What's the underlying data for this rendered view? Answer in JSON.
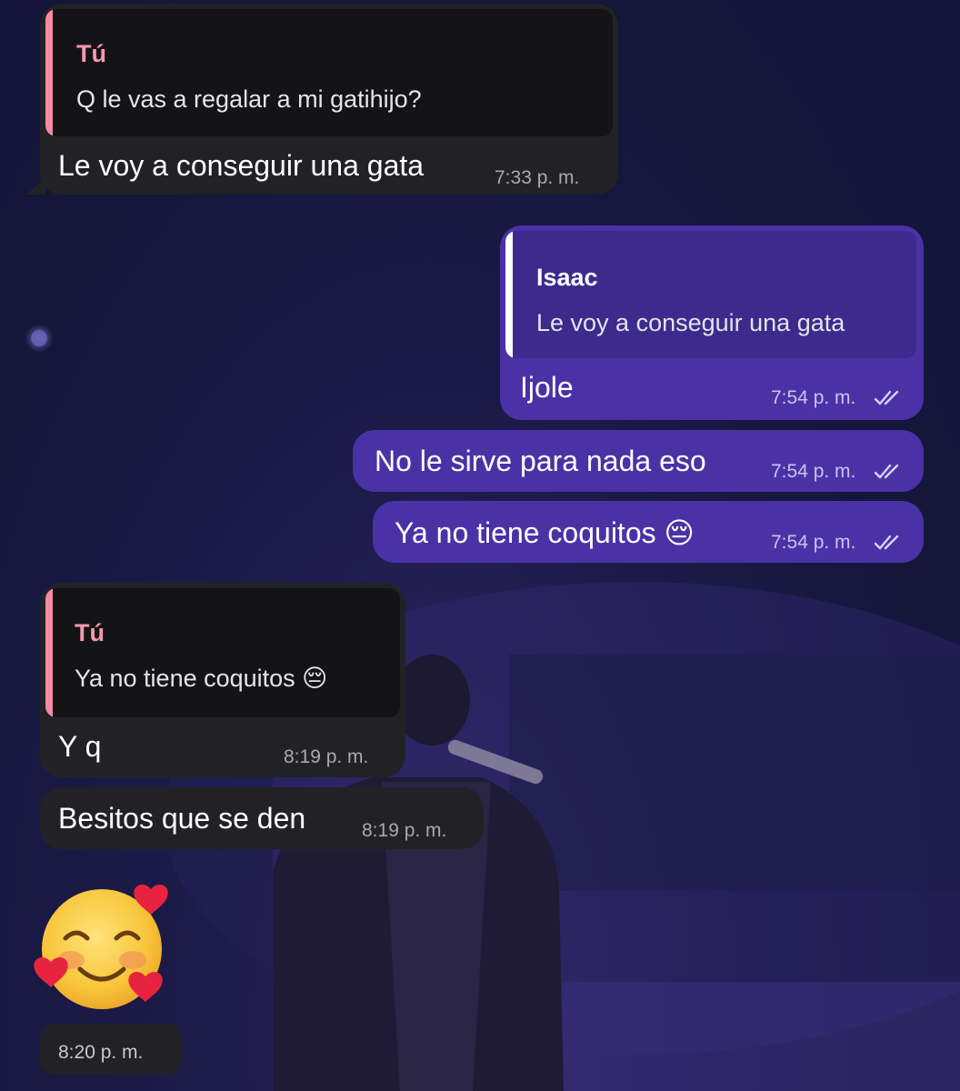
{
  "messages": [
    {
      "direction": "incoming",
      "reply_to": {
        "author": "Tú",
        "text": "Q le vas a regalar a mi gatihijo?"
      },
      "text": "Le voy a conseguir una gata",
      "time": "7:33 p. m."
    },
    {
      "direction": "outgoing",
      "reply_to": {
        "author": "Isaac",
        "text": "Le voy a conseguir una gata"
      },
      "text": "Ijole",
      "time": "7:54 p. m.",
      "status": "read"
    },
    {
      "direction": "outgoing",
      "text": "No le sirve para nada eso",
      "time": "7:54 p. m.",
      "status": "read"
    },
    {
      "direction": "outgoing",
      "text": "Ya no tiene coquitos 😔",
      "time": "7:54 p. m.",
      "status": "read"
    },
    {
      "direction": "incoming",
      "reply_to": {
        "author": "Tú",
        "text": "Ya no tiene coquitos 😔"
      },
      "text": "Y q",
      "time": "8:19 p. m."
    },
    {
      "direction": "incoming",
      "text": "Besitos que se den",
      "time": "8:19 p. m."
    },
    {
      "direction": "incoming",
      "sticker": "smiling-face-with-hearts-emoji",
      "time": "8:20 p. m."
    }
  ],
  "colors": {
    "incoming_bubble": "#222226",
    "outgoing_bubble": "#4a32a6",
    "incoming_quote_accent": "#f48aa3",
    "outgoing_quote_accent": "#ffffff"
  }
}
